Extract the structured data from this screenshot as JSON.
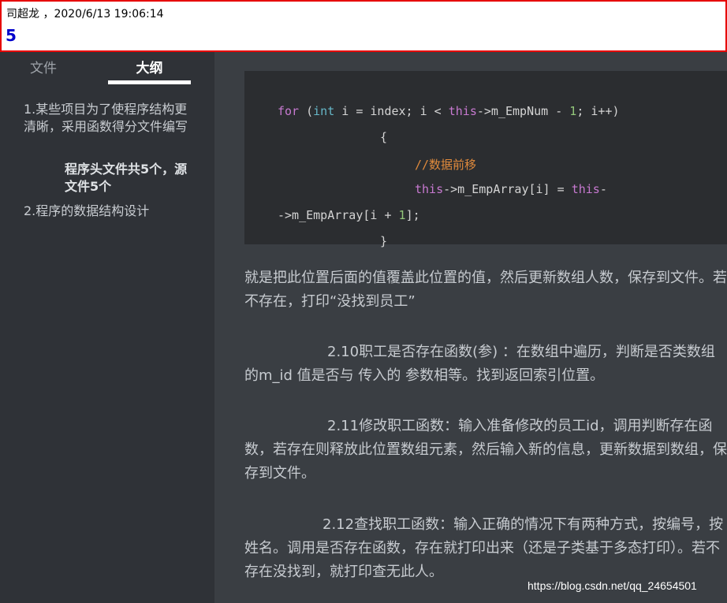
{
  "header": {
    "meta": "司超龙 ，2020/6/13 19:06:14",
    "count": "5"
  },
  "sidebar": {
    "tabs": [
      {
        "label": "文件",
        "active": false
      },
      {
        "label": "大纲",
        "active": true
      }
    ],
    "outline": [
      "1.某些项目为了使程序结构更清晰，采用函数得分文件编写",
      "程序头文件共5个，源文件5个",
      "2.程序的数据结构设计"
    ]
  },
  "code": {
    "l1": {
      "kw1": "for",
      "p1": " (",
      "ty": "int",
      "p2": " i = index; i < ",
      "kw2": "this",
      "p3": "->m_EmpNum - ",
      "num": "1",
      "p4": "; i++)"
    },
    "l2": "{",
    "l3": "//数据前移",
    "l4": {
      "kw1": "this",
      "p1": "->m_EmpArray[i] = ",
      "kw2": "this",
      "p2": "-"
    },
    "l5": {
      "p1": "->m_EmpArray[i + ",
      "num": "1",
      "p2": "];"
    },
    "l6": "}"
  },
  "content": {
    "p1": "就是把此位置后面的值覆盖此位置的值，然后更新数组人数，保存到文件。若不存在，打印“没找到员工”",
    "p2": "2.10职工是否存在函数(参) ：在数组中遍历，判断是否类数组的m_id 值是否与 传入的 参数相等。找到返回索引位置。",
    "p3": "2.11修改职工函数：输入准备修改的员工id，调用判断存在函数，若存在则释放此位置数组元素，然后输入新的信息，更新数据到数组，保存到文件。",
    "p4": "2.12查找职工函数：输入正确的情况下有两种方式，按编号，按姓名。调用是否存在函数，存在就打印出来（还是子类基于多态打印）。若不存在没找到，就打印查无此人。"
  },
  "watermark": "https://blog.csdn.net/qq_24654501",
  "colors": {
    "topbar_border": "#e60000",
    "count_color": "#0000cc",
    "sidebar_bg": "#2f3237",
    "main_bg": "#3a3e43",
    "code_bg": "#2b2d30",
    "keyword": "#c779d0",
    "type": "#66b7c8",
    "number": "#93c77a",
    "comment": "#e08a3c"
  }
}
